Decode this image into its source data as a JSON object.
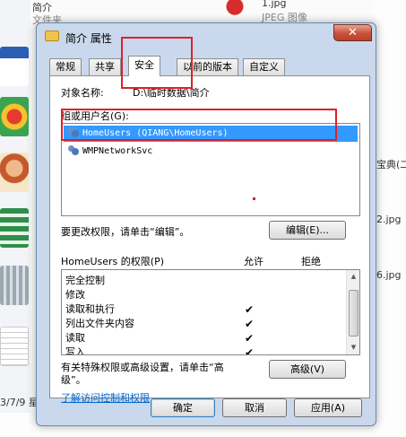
{
  "background": {
    "left_items": [
      "简介",
      "文件夹"
    ],
    "top_right_file": "1.jpg",
    "top_right_type": "JPEG 图像",
    "right_items": [
      "宝典(二",
      "2.jpg",
      "6.jpg"
    ],
    "bottom_date": "3/7/9 星"
  },
  "dialog": {
    "title": "简介 属性",
    "close_symbol": "✕",
    "tabs": [
      "常规",
      "共享",
      "安全",
      "以前的版本",
      "自定义"
    ],
    "object_name_label": "对象名称:",
    "object_name_value": "D:\\临时数据\\简介",
    "group_label": "组或用户名(G):",
    "users": [
      {
        "name": "HomeUsers (QIANG\\HomeUsers)",
        "selected": true
      },
      {
        "name": "WMPNetworkSvc",
        "selected": false
      }
    ],
    "change_perm_text": "要更改权限，请单击“编辑”。",
    "edit_button": "编辑(E)...",
    "perm_header_label": "HomeUsers 的权限(P)",
    "perm_allow_label": "允许",
    "perm_deny_label": "拒绝",
    "permissions": [
      {
        "name": "完全控制",
        "allow": false
      },
      {
        "name": "修改",
        "allow": false
      },
      {
        "name": "读取和执行",
        "allow": true
      },
      {
        "name": "列出文件夹内容",
        "allow": true
      },
      {
        "name": "读取",
        "allow": true
      },
      {
        "name": "写入",
        "allow": true
      }
    ],
    "check_symbol": "✔",
    "special_text_line1": "有关特殊权限或高级设置，请单击“高",
    "special_text_line2": "级”。",
    "advanced_button": "高级(V)",
    "learn_link": "了解访问控制和权限",
    "ok_button": "确定",
    "cancel_button": "取消",
    "apply_button": "应用(A)"
  },
  "colors": {
    "highlight_box": "#e0202a",
    "selection": "#3399ff",
    "dialog_frame": "#c9d8ec",
    "link": "#0066cc"
  }
}
